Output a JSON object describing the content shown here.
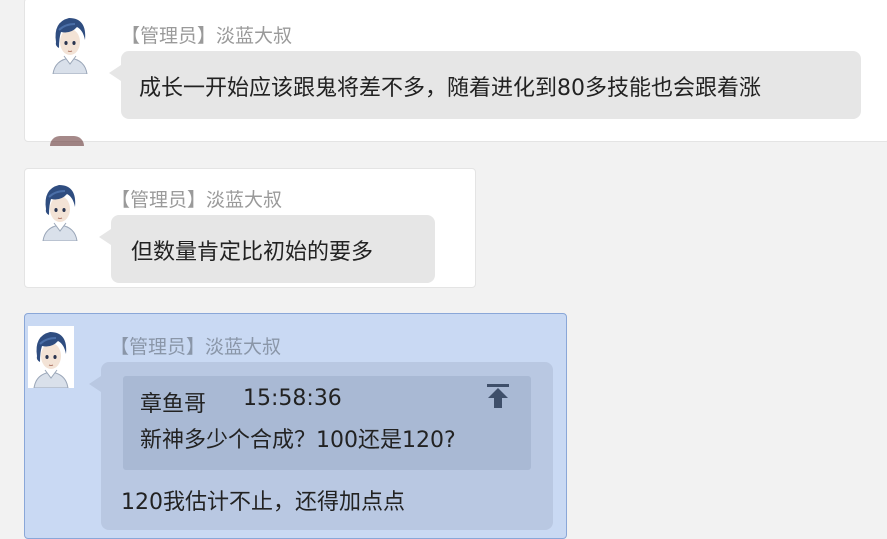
{
  "messages": [
    {
      "sender": "【管理员】淡蓝大叔",
      "text": "成长一开始应该跟鬼将差不多，随着进化到80多技能也会跟着涨"
    },
    {
      "sender": "【管理员】淡蓝大叔",
      "text": "但数量肯定比初始的要多"
    },
    {
      "sender": "【管理员】淡蓝大叔",
      "quote": {
        "author": "章鱼哥",
        "time": "15:58:36",
        "text": "新神多少个合成？100还是120?"
      },
      "text": "120我估计不止，还得加点点"
    }
  ],
  "icons": {
    "avatar": "anime-boy-avatar-icon",
    "jump": "jump-to-original-arrow-icon"
  },
  "colors": {
    "selected_background": "#c9d9f3",
    "bubble": "#e6e6e6",
    "sender_text": "#9a9a9a"
  }
}
